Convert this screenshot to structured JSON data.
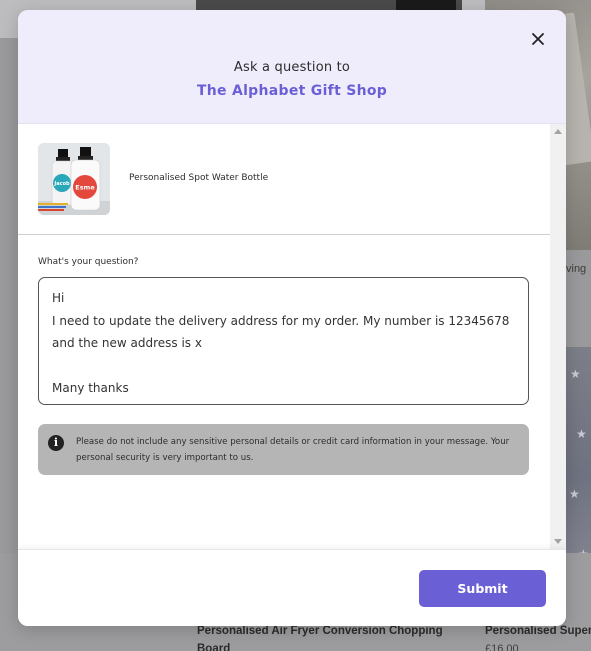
{
  "modal": {
    "header_prefix": "Ask a question to",
    "shop_name": "The Alphabet Gift Shop",
    "product_name": "Personalised Spot Water Bottle",
    "question_label": "What's your question?",
    "question_value": "Hi\nI need to update the delivery address for my order. My number is 12345678 and the new address is x\n\nMany thanks",
    "notice": "Please do not include any sensitive personal details or credit card information in your message. Your personal security is very important to us.",
    "submit_label": "Submit",
    "icons": {
      "close": "close-icon",
      "info": "info-icon",
      "scroll_up": "scroll-up-icon",
      "scroll_down": "scroll-down-icon"
    },
    "thumbnail_names": [
      "Jacob",
      "Esme"
    ]
  },
  "background": {
    "side_label": "ving",
    "product_titles": [
      "Personalised Air Fryer Conversion Chopping Board",
      "Personalised Super"
    ],
    "price_partial": "£16.00"
  },
  "colors": {
    "accent": "#6b5fd6",
    "header_bg": "#efedfc",
    "notice_bg": "#b5b5b5",
    "overlay": "#9a9a9c"
  }
}
